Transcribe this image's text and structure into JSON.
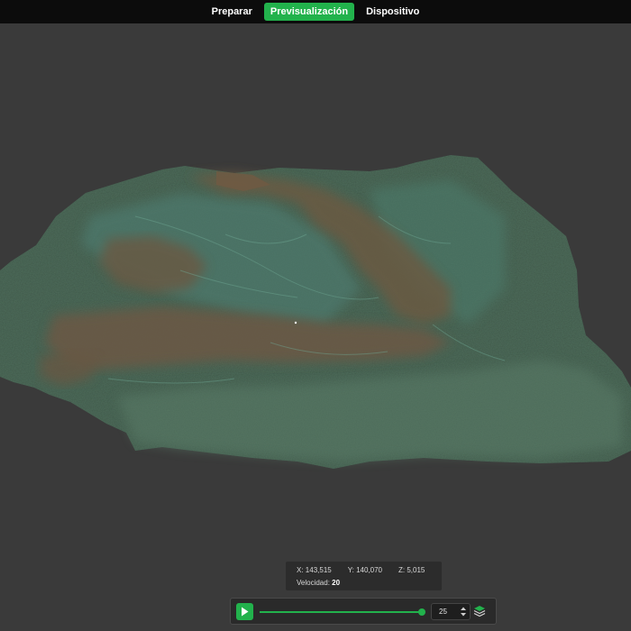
{
  "tabs": [
    {
      "label": "Preparar",
      "active": false
    },
    {
      "label": "Previsualización",
      "active": true
    },
    {
      "label": "Dispositivo",
      "active": false
    }
  ],
  "accent_color": "#22b24c",
  "readout": {
    "x_label": "X:",
    "x_value": "143,515",
    "y_label": "Y:",
    "y_value": "140,070",
    "z_label": "Z:",
    "z_value": "5,015",
    "speed_label": "Velocidad:",
    "speed_value": "20"
  },
  "controls": {
    "play_icon": "play-icon",
    "slider_fraction": 0.99,
    "layer_value": "25",
    "stepper_icon": "up-down-arrows-icon",
    "layers_icon": "layers-icon"
  }
}
